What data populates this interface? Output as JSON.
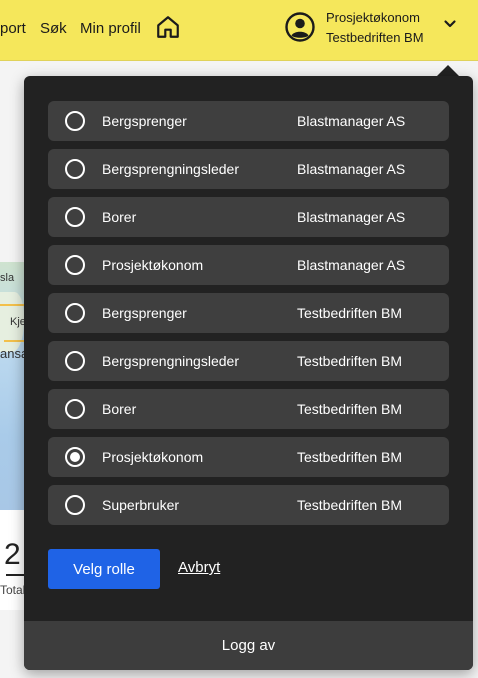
{
  "header": {
    "nav": [
      "port",
      "Søk",
      "Min profil"
    ],
    "home_icon": "home-icon",
    "profile": {
      "icon": "account-circle-icon",
      "role": "Prosjektøkonom",
      "company": "Testbedriften BM",
      "chevron": "chevron-down-icon"
    }
  },
  "background": {
    "map_labels": [
      "sla",
      "Kje",
      "ansa"
    ],
    "number_fragment": "2",
    "total_fragment": "Total"
  },
  "role_menu": {
    "roles": [
      {
        "name": "Bergsprenger",
        "company": "Blastmanager AS",
        "selected": false
      },
      {
        "name": "Bergsprengningsleder",
        "company": "Blastmanager AS",
        "selected": false
      },
      {
        "name": "Borer",
        "company": "Blastmanager AS",
        "selected": false
      },
      {
        "name": "Prosjektøkonom",
        "company": "Blastmanager AS",
        "selected": false
      },
      {
        "name": "Bergsprenger",
        "company": "Testbedriften BM",
        "selected": false
      },
      {
        "name": "Bergsprengningsleder",
        "company": "Testbedriften BM",
        "selected": false
      },
      {
        "name": "Borer",
        "company": "Testbedriften BM",
        "selected": false
      },
      {
        "name": "Prosjektøkonom",
        "company": "Testbedriften BM",
        "selected": true
      },
      {
        "name": "Superbruker",
        "company": "Testbedriften BM",
        "selected": false
      }
    ],
    "select_button": "Velg rolle",
    "cancel_link": "Avbryt",
    "logout": "Logg av"
  },
  "colors": {
    "header_bg": "#f5e75b",
    "panel_bg": "#222222",
    "item_bg": "#3f3f3f",
    "primary": "#1f63e6"
  }
}
